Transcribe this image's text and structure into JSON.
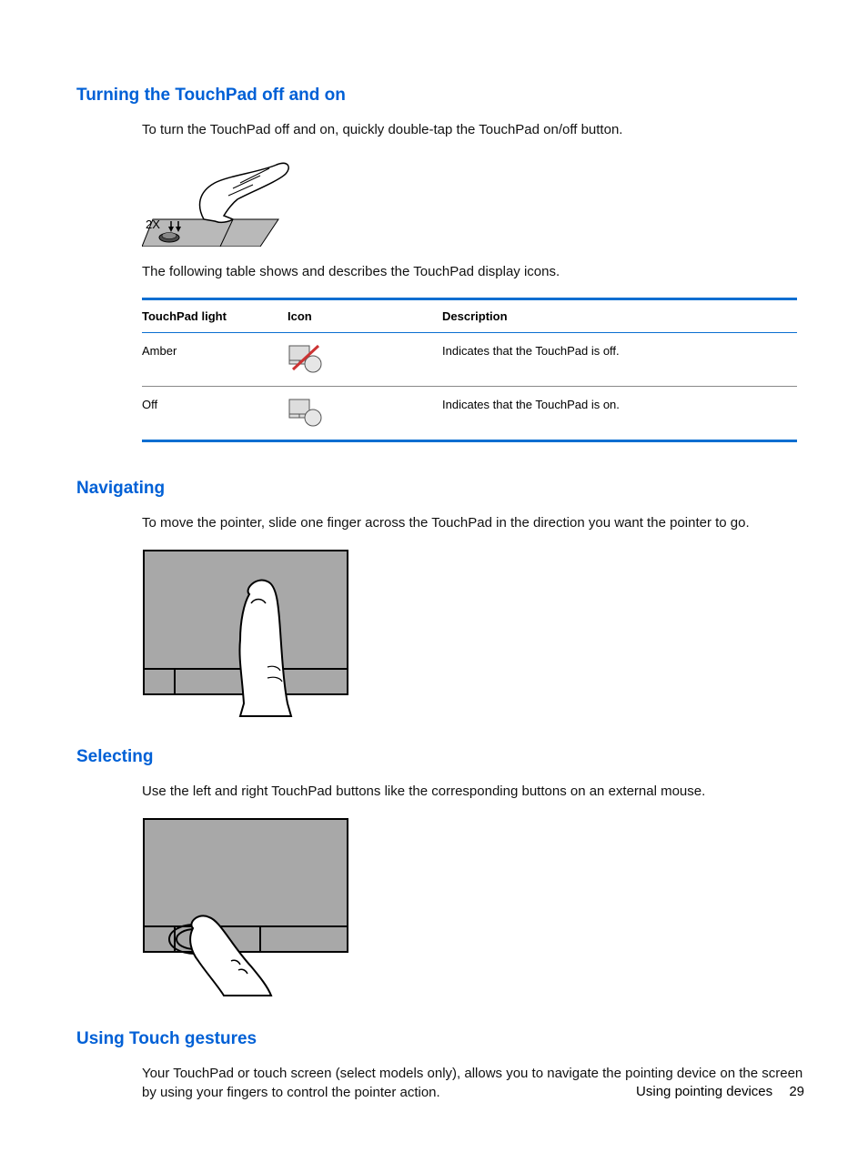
{
  "sections": {
    "turning": {
      "heading": "Turning the TouchPad off and on",
      "intro": "To turn the TouchPad off and on, quickly double-tap the TouchPad on/off button.",
      "diagram_label": "2X",
      "table_intro": "The following table shows and describes the TouchPad display icons.",
      "table": {
        "headers": {
          "light": "TouchPad light",
          "icon": "Icon",
          "desc": "Description"
        },
        "rows": [
          {
            "light": "Amber",
            "desc": "Indicates that the TouchPad is off."
          },
          {
            "light": "Off",
            "desc": "Indicates that the TouchPad is on."
          }
        ]
      }
    },
    "navigating": {
      "heading": "Navigating",
      "intro": "To move the pointer, slide one finger across the TouchPad in the direction you want the pointer to go."
    },
    "selecting": {
      "heading": "Selecting",
      "intro": "Use the left and right TouchPad buttons like the corresponding buttons on an external mouse."
    },
    "gestures": {
      "heading": "Using Touch gestures",
      "intro": "Your TouchPad or touch screen (select models only), allows you to navigate the pointing device on the screen by using your fingers to control the pointer action."
    }
  },
  "footer": {
    "section": "Using pointing devices",
    "page": "29"
  }
}
